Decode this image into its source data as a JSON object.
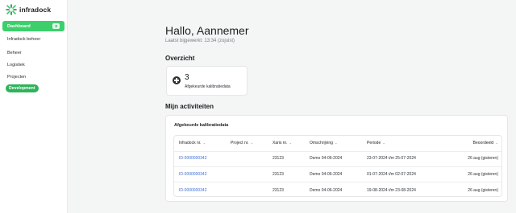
{
  "brand": {
    "name": "infradock",
    "accent": "#3ccf6c"
  },
  "sidebar": {
    "active": {
      "label": "Dashboard",
      "badge": "3"
    },
    "items": [
      {
        "label": "Infradock beheer"
      },
      {
        "label": "Beheer"
      },
      {
        "label": "Logistiek"
      },
      {
        "label": "Projecten"
      }
    ],
    "dev_pill": "Development"
  },
  "main": {
    "greeting": "Hallo, Aannemer",
    "last_updated": "Laatst bijgewerkt: 13:34 (zojuist)",
    "overview": {
      "title": "Overzicht",
      "card": {
        "icon": "plus-circle-icon",
        "value": "3",
        "label": "Afgekeurde kalibratiedata"
      }
    },
    "activities": {
      "title": "Mijn activiteiten",
      "panel_title": "Afgekeurde kalibratiedata",
      "columns": [
        "Infradock nr.",
        "Project nr.",
        "Xaris nr.",
        "Omschrijving",
        "Periode",
        "Beoordeeld"
      ],
      "rows": [
        {
          "infradock": "ID-0000000342",
          "project": "",
          "xaris": "23123",
          "omschrijving": "Demo 04-06-2024",
          "periode": "23-07-2024 t/m 25-07-2024",
          "beoordeeld": "26 aug (gisteren)"
        },
        {
          "infradock": "ID-0000000342",
          "project": "",
          "xaris": "23123",
          "omschrijving": "Demo 04-06-2024",
          "periode": "01-07-2024 t/m 02-07-2024",
          "beoordeeld": "26 aug (gisteren)"
        },
        {
          "infradock": "ID-0000000342",
          "project": "",
          "xaris": "23123",
          "omschrijving": "Demo 04-06-2024",
          "periode": "19-08-2024 t/m 23-08-2024",
          "beoordeeld": "26 aug (gisteren)"
        }
      ]
    }
  }
}
